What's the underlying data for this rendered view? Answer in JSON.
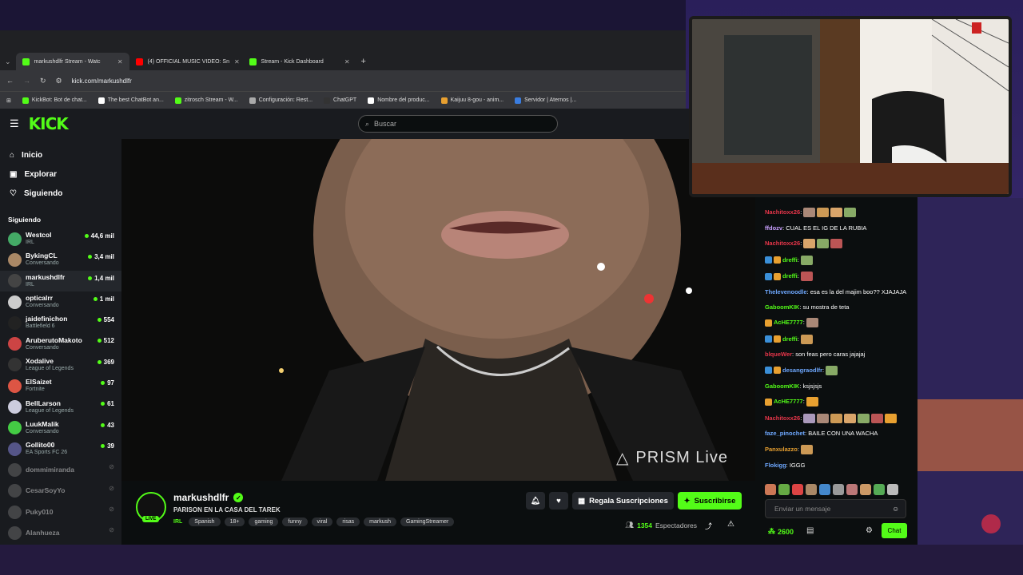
{
  "browser": {
    "tabs": [
      {
        "label": "markushdlfr Stream - Watc",
        "icon_color": "#53fc18"
      },
      {
        "label": "(4) OFFICIAL MUSIC VIDEO: Sn",
        "icon_color": "#ff0000"
      },
      {
        "label": "Stream - Kick Dashboard",
        "icon_color": "#53fc18"
      }
    ],
    "url": "kick.com/markushdlfr",
    "bookmarks": [
      {
        "label": "KickBot: Bot de chat...",
        "color": "#53fc18"
      },
      {
        "label": "The best ChatBot an...",
        "color": "#ffffff"
      },
      {
        "label": "zitrosch Stream - W...",
        "color": "#53fc18"
      },
      {
        "label": "Configuración: Rest...",
        "color": "#aaaaaa"
      },
      {
        "label": "ChatGPT",
        "color": "#333333"
      },
      {
        "label": "Nombre del produc...",
        "color": "#ffffff"
      },
      {
        "label": "Kaijuu 8-gou - anim...",
        "color": "#e8a030"
      },
      {
        "label": "Servidor | Aternos |...",
        "color": "#3a7de0"
      }
    ]
  },
  "kick": {
    "logo": "KICK",
    "search_placeholder": "Buscar",
    "nav": [
      {
        "label": "Inicio",
        "icon": "home-icon"
      },
      {
        "label": "Explorar",
        "icon": "compass-icon"
      },
      {
        "label": "Siguiendo",
        "icon": "heart-icon"
      }
    ],
    "following_title": "Siguiendo",
    "channels": [
      {
        "name": "Westcol",
        "category": "IRL",
        "viewers": "44,6 mil",
        "color": "#4a6",
        "live": true
      },
      {
        "name": "BykingCL",
        "category": "Conversando",
        "viewers": "3,4 mil",
        "color": "#a86",
        "live": true
      },
      {
        "name": "markushdlfr",
        "category": "IRL",
        "viewers": "1,4 mil",
        "color": "#444",
        "live": true,
        "active": true
      },
      {
        "name": "opticalrr",
        "category": "Conversando",
        "viewers": "1 mil",
        "color": "#ccc",
        "live": true
      },
      {
        "name": "jaidefinichon",
        "category": "Battlefield 6",
        "viewers": "554",
        "color": "#222",
        "live": true
      },
      {
        "name": "AruberutoMakoto",
        "category": "Conversando",
        "viewers": "512",
        "color": "#c44",
        "live": true
      },
      {
        "name": "Xodalive",
        "category": "League of Legends",
        "viewers": "369",
        "color": "#333",
        "live": true
      },
      {
        "name": "ElSaizet",
        "category": "Fortnite",
        "viewers": "97",
        "color": "#d54",
        "live": true
      },
      {
        "name": "BellLarson",
        "category": "League of Legends",
        "viewers": "61",
        "color": "#ccd",
        "live": true
      },
      {
        "name": "LuukMalik",
        "category": "Conversando",
        "viewers": "43",
        "color": "#4c4",
        "live": true
      },
      {
        "name": "Gollito00",
        "category": "EA Sports FC 26",
        "viewers": "39",
        "color": "#558",
        "live": true
      },
      {
        "name": "dommimiranda",
        "category": "",
        "viewers": "",
        "color": "#777",
        "live": false
      },
      {
        "name": "CesarSoyYo",
        "category": "",
        "viewers": "",
        "color": "#777",
        "live": false
      },
      {
        "name": "Puky010",
        "category": "",
        "viewers": "",
        "color": "#777",
        "live": false
      },
      {
        "name": "Alanhueza",
        "category": "",
        "viewers": "",
        "color": "#777",
        "live": false
      }
    ],
    "stream": {
      "watermark": "PRISM Live",
      "streamer": "markushdlfr",
      "live_badge": "LIVE",
      "title": "PARISON EN LA CASA DEL TAREK",
      "category": "IRL",
      "tags": [
        "Spanish",
        "18+",
        "gaming",
        "funny",
        "viral",
        "risas",
        "markush",
        "GamingStreamer"
      ],
      "gift_label": "Regala Suscripciones",
      "subscribe_label": "Suscribirse",
      "viewer_count": "1354",
      "viewer_suffix": "Espectadores"
    },
    "chat": {
      "messages": [
        {
          "user": "Nachitoxx26",
          "color": "#e8364a",
          "text": "",
          "emotes": 4
        },
        {
          "user": "ffdozv",
          "color": "#c9a0ff",
          "text": "CUAL ES EL IG DE LA RUBIA",
          "emotes": 0
        },
        {
          "user": "Nachitoxx26",
          "color": "#e8364a",
          "text": "",
          "emotes": 3
        },
        {
          "user": "dreffi",
          "color": "#53fc18",
          "text": "",
          "emotes": 1,
          "badges": 2
        },
        {
          "user": "dreffi",
          "color": "#53fc18",
          "text": "",
          "emotes": 1,
          "badges": 2
        },
        {
          "user": "Thelevenoodle",
          "color": "#6ea8ff",
          "text": "esa es la del majim boo?? XJAJAJA",
          "emotes": 0
        },
        {
          "user": "GaboomKIK",
          "color": "#53fc18",
          "text": "su mostra de teta",
          "emotes": 0
        },
        {
          "user": "AcHE7777",
          "color": "#53fc18",
          "text": "",
          "emotes": 1,
          "badges": 1
        },
        {
          "user": "dreffi",
          "color": "#53fc18",
          "text": "",
          "emotes": 1,
          "badges": 2
        },
        {
          "user": "blqueWer",
          "color": "#e8364a",
          "text": "son feas pero caras jajajaj",
          "emotes": 0
        },
        {
          "user": "desangraodlfr",
          "color": "#6ea8ff",
          "text": "",
          "emotes": 1,
          "badges": 2
        },
        {
          "user": "GaboomKIK",
          "color": "#53fc18",
          "text": "ksjsjsjs",
          "emotes": 0
        },
        {
          "user": "AcHE7777",
          "color": "#53fc18",
          "text": "",
          "emotes": 1,
          "badges": 1
        },
        {
          "user": "Nachitoxx26",
          "color": "#e8364a",
          "text": "",
          "emotes": 7
        },
        {
          "user": "faze_pinochet",
          "color": "#6ea8ff",
          "text": "BAILE CON UNA WACHA",
          "emotes": 0
        },
        {
          "user": "Panxulazzo",
          "color": "#e8a030",
          "text": "",
          "emotes": 1
        },
        {
          "user": "Flokigg",
          "color": "#6ea8ff",
          "text": "IGGG",
          "emotes": 0
        }
      ],
      "input_placeholder": "Enviar un mensaje",
      "points": "2600",
      "chat_button": "Chat"
    }
  }
}
